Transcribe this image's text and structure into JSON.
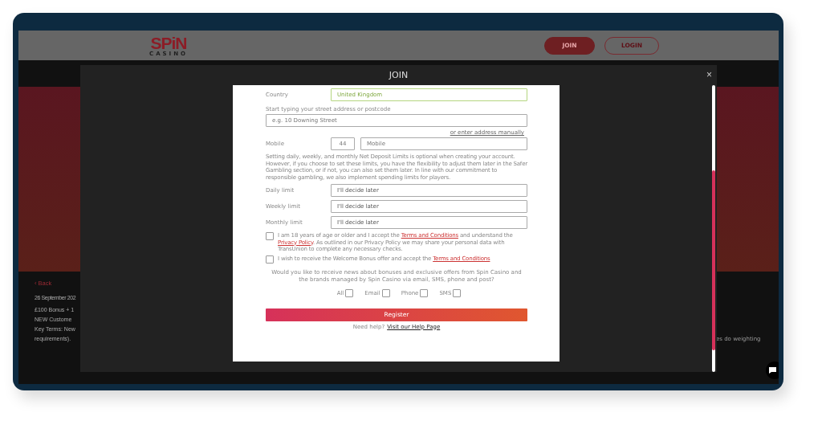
{
  "site": {
    "logo_word": "SPiN",
    "logo_sub": "CASINO",
    "buttons": [
      {
        "label": "JOIN",
        "kind": "filled"
      },
      {
        "label": "LOGIN",
        "kind": "outline"
      }
    ]
  },
  "article": {
    "back": "‹ Back",
    "date": "26 September 202",
    "lines": [
      "£100 Bonus + 1",
      "NEW Custome",
      "Key Terms: New",
      "requirements)."
    ],
    "right_fragment": "es do weighting"
  },
  "modal": {
    "title": "JOIN",
    "close": "×",
    "country": {
      "label": "Country",
      "value": "United Kingdom",
      "valid": true
    },
    "address": {
      "label": "Start typing your street address or postcode",
      "placeholder": "e.g. 10 Downing Street",
      "manual_link": "or enter address manually"
    },
    "mobile": {
      "label": "Mobile",
      "code": "44",
      "placeholder": "Mobile"
    },
    "limits_note": "Setting daily, weekly, and monthly Net Deposit Limits is optional when creating your account. However, if you choose to set these limits, you have the flexibility to adjust them later in the Safer Gambling section, or if not, you can also set them later. In line with our commitment to responsible gambling, we also implement spending limits for players.",
    "limits": [
      {
        "label": "Daily limit",
        "value": "I'll decide later"
      },
      {
        "label": "Weekly limit",
        "value": "I'll decide later"
      },
      {
        "label": "Monthly limit",
        "value": "I'll decide later"
      }
    ],
    "consents": [
      {
        "checked": false,
        "parts": [
          {
            "kind": "text",
            "text": "I am 18 years of age or older and I accept the "
          },
          {
            "kind": "link",
            "text": "Terms and Conditions"
          },
          {
            "kind": "text",
            "text": " and understand the "
          },
          {
            "kind": "link",
            "text": "Privacy Policy"
          },
          {
            "kind": "text",
            "text": ". As outlined in our Privacy Policy we may share your personal data with TransUnion to complete any necessary checks."
          }
        ]
      },
      {
        "checked": false,
        "parts": [
          {
            "kind": "text",
            "text": "I wish to receive the Welcome Bonus offer and accept the "
          },
          {
            "kind": "link",
            "text": "Terms and Conditions"
          }
        ]
      }
    ],
    "marketing_question": "Would you like to receive news about bonuses and exclusive offers from Spin Casino and the brands managed by Spin Casino via email, SMS, phone and post?",
    "channels": [
      {
        "label": "All",
        "checked": false
      },
      {
        "label": "Email",
        "checked": false
      },
      {
        "label": "Phone",
        "checked": false
      },
      {
        "label": "SMS",
        "checked": false
      }
    ],
    "register": "Register",
    "help_text": "Need help?",
    "help_link": "Visit our Help Page"
  }
}
